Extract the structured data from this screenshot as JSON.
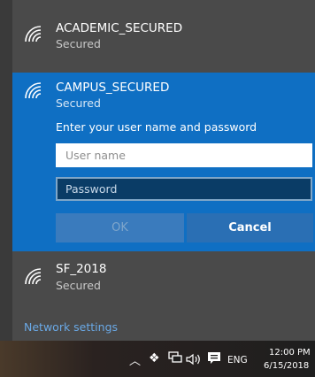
{
  "networks": [
    {
      "name": "ACADEMIC_SECURED",
      "status": "Secured"
    },
    {
      "name": "CAMPUS_SECURED",
      "status": "Secured"
    },
    {
      "name": "SF_2018",
      "status": "Secured"
    }
  ],
  "connect_form": {
    "prompt": "Enter your user name and password",
    "username_placeholder": "User name",
    "password_placeholder": "Password",
    "ok_label": "OK",
    "cancel_label": "Cancel"
  },
  "network_settings_label": "Network settings",
  "taskbar": {
    "icons": [
      "chevron-up-icon",
      "dropbox-icon",
      "network-icon",
      "volume-icon",
      "notification-icon"
    ],
    "language": "ENG",
    "time": "12:00 PM",
    "date": "6/15/2018"
  },
  "colors": {
    "flyout_bg": "#4a4a4a",
    "selected_bg": "#0f6fc3",
    "link": "#6aa9e6"
  }
}
